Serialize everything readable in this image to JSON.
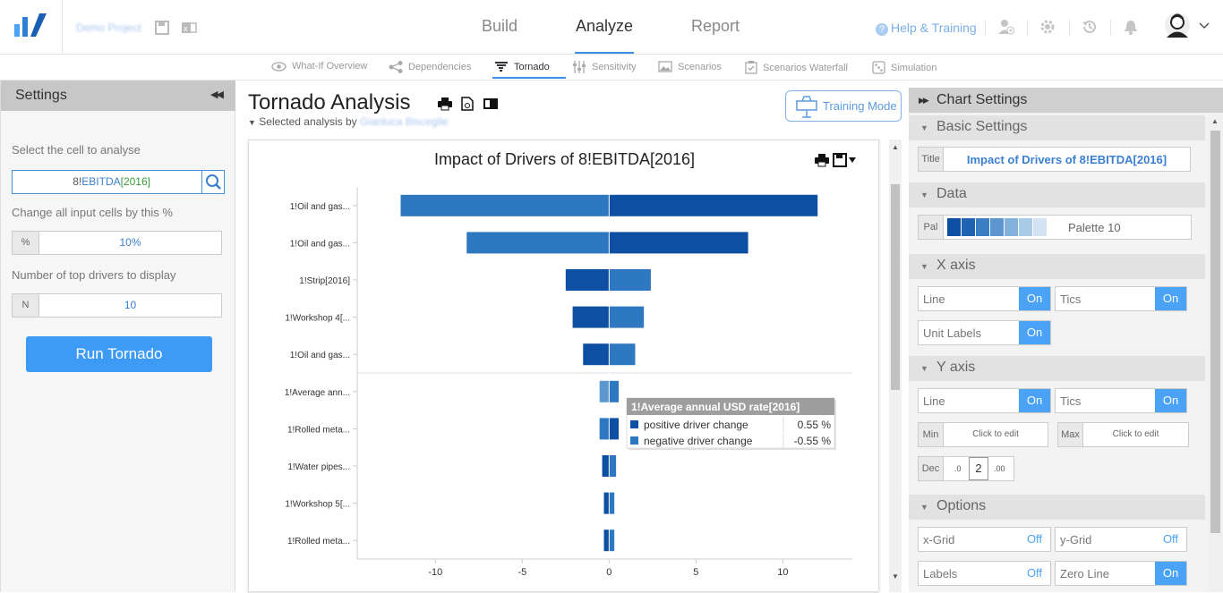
{
  "header": {
    "project_name": "Demo Project",
    "nav": [
      "Build",
      "Analyze",
      "Report"
    ],
    "help_label": "Help & Training"
  },
  "subnav": [
    {
      "label": "What-If Overview",
      "icon": "eye-icon"
    },
    {
      "label": "Dependencies",
      "icon": "share-icon"
    },
    {
      "label": "Tornado",
      "icon": "tornado-icon"
    },
    {
      "label": "Sensitivity",
      "icon": "sliders-icon"
    },
    {
      "label": "Scenarios",
      "icon": "image-icon"
    },
    {
      "label": "Scenarios Waterfall",
      "icon": "clipboard-check-icon"
    },
    {
      "label": "Simulation",
      "icon": "dice-icon"
    }
  ],
  "settings": {
    "title": "Settings",
    "cell_label": "Select the cell to analyse",
    "cell_prefix": "8!",
    "cell_name": "EBITDA",
    "cell_year": "[2016]",
    "change_label": "Change all input cells by this %",
    "change_prefix": "%",
    "change_value": "10%",
    "drivers_label": "Number of top drivers to display",
    "drivers_prefix": "N",
    "drivers_value": "10",
    "run_label": "Run Tornado"
  },
  "analysis": {
    "title": "Tornado Analysis",
    "selected_by_prefix": "Selected analysis by",
    "selected_by_name": "Gianluca Bisceglie",
    "training_label": "Training Mode"
  },
  "chart_data": {
    "type": "bar",
    "orientation": "horizontal",
    "title": "Impact of Drivers of 8!EBITDA[2016]",
    "categories": [
      "1!Oil and gas...",
      "1!Oil and gas...",
      "1!Strip[2016]",
      "1!Workshop 4[...",
      "1!Oil and gas...",
      "1!Average ann...",
      "1!Rolled meta...",
      "1!Water pipes...",
      "1!Workshop 5[...",
      "1!Rolled meta..."
    ],
    "series": [
      {
        "name": "positive driver change",
        "values": [
          12,
          8,
          -2.5,
          -2.1,
          -1.5,
          0.55,
          0.55,
          -0.4,
          -0.3,
          -0.3
        ]
      },
      {
        "name": "negative driver change",
        "values": [
          -12,
          -8.2,
          2.4,
          2.0,
          1.5,
          -0.55,
          -0.55,
          0.4,
          0.3,
          0.3
        ]
      }
    ],
    "xlim": [
      -14.5,
      14
    ],
    "xticks": [
      "-10",
      "-5",
      "0",
      "5",
      "10"
    ],
    "tooltip": {
      "title": "1!Average annual USD rate[2016]",
      "rows": [
        {
          "label": "positive driver change",
          "value": "0.55 %"
        },
        {
          "label": "negative driver change",
          "value": "-0.55 %"
        }
      ]
    }
  },
  "chart_settings": {
    "header": "Chart Settings",
    "basic": {
      "section": "Basic Settings",
      "title_label": "Title",
      "title_value": "Impact of Drivers of 8!EBITDA[2016]"
    },
    "data": {
      "section": "Data",
      "palette_label": "Pal",
      "palette_name": "Palette 10",
      "palette_colors": [
        "#0d4fa2",
        "#1f64b2",
        "#3a7fc4",
        "#5c98cf",
        "#82b2dc",
        "#a8cbe7",
        "#d3e3f3"
      ]
    },
    "x_axis": {
      "section": "X axis",
      "line_label": "Line",
      "line_value": "On",
      "tics_label": "Tics",
      "tics_value": "On",
      "unit_label": "Unit Labels",
      "unit_value": "On"
    },
    "y_axis": {
      "section": "Y axis",
      "line_label": "Line",
      "line_value": "On",
      "tics_label": "Tics",
      "tics_value": "On",
      "min_label": "Min",
      "min_value": "Click to edit",
      "max_label": "Max",
      "max_value": "Click to edit",
      "dec_label": "Dec",
      "dec_less": ".0",
      "dec_value": "2",
      "dec_more": ".00"
    },
    "options": {
      "section": "Options",
      "xgrid_label": "x-Grid",
      "xgrid_value": "Off",
      "ygrid_label": "y-Grid",
      "ygrid_value": "Off",
      "labels_label": "Labels",
      "labels_value": "Off",
      "zeroline_label": "Zero Line",
      "zeroline_value": "On"
    }
  },
  "colors": {
    "accent": "#3d9af5",
    "bar_dark": "#0d4fa2",
    "bar_light": "#2d78c0"
  }
}
